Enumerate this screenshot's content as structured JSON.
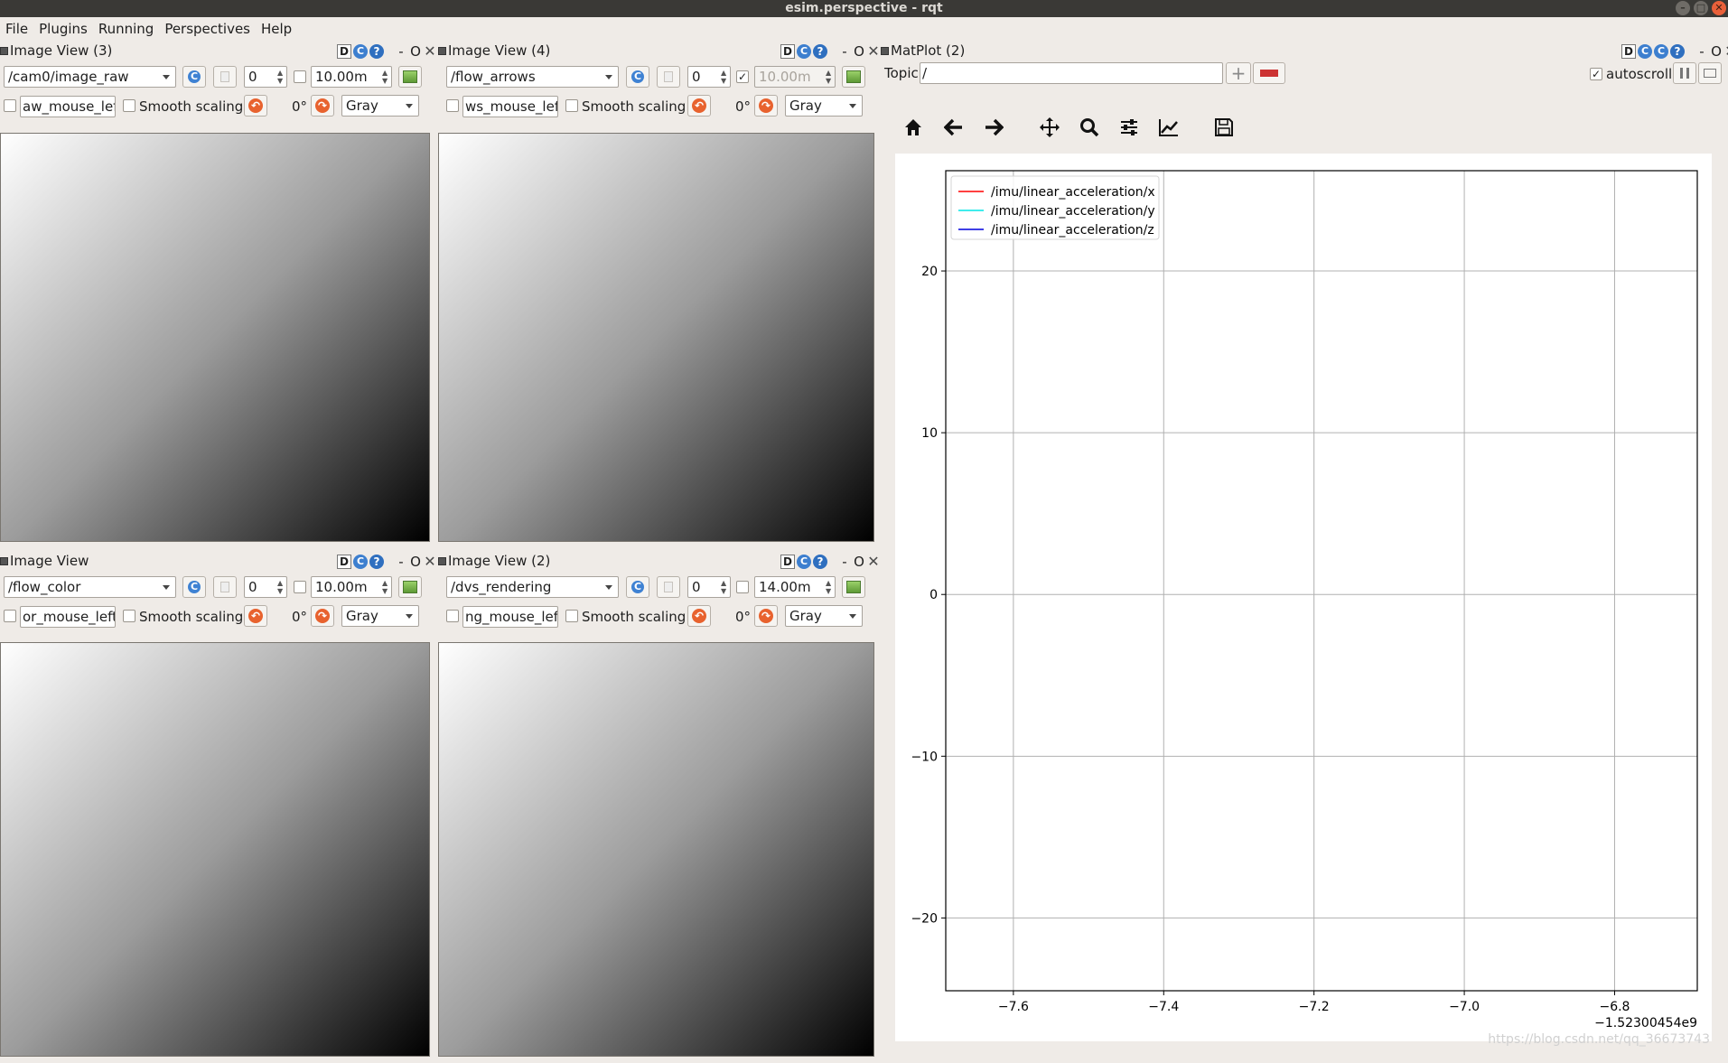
{
  "window": {
    "title": "esim.perspective - rqt",
    "buttons": [
      "–",
      "□",
      "✕"
    ]
  },
  "menu": {
    "items": [
      "File",
      "Plugins",
      "Running",
      "Perspectives",
      "Help"
    ]
  },
  "dock_controls": {
    "d": "D",
    "c": "C",
    "q": "?",
    "dash": "-",
    "o": "O",
    "x": "✕"
  },
  "panels": [
    {
      "title": "Image View (3)",
      "topic": "/cam0/image_raw",
      "spin_value": "0",
      "fps_checked": "",
      "fps_value": "10.00m",
      "mouse_topic": "aw_mouse_left",
      "smooth_label": "Smooth scaling",
      "rotation": "0°",
      "colormap": "Gray"
    },
    {
      "title": "Image View (4)",
      "topic": "/flow_arrows",
      "spin_value": "0",
      "fps_checked": "✓",
      "fps_value": "10.00m",
      "mouse_topic": "ws_mouse_left",
      "smooth_label": "Smooth scaling",
      "rotation": "0°",
      "colormap": "Gray"
    },
    {
      "title": "Image View",
      "topic": "/flow_color",
      "spin_value": "0",
      "fps_checked": "",
      "fps_value": "10.00m",
      "mouse_topic": "or_mouse_left",
      "smooth_label": "Smooth scaling",
      "rotation": "0°",
      "colormap": "Gray"
    },
    {
      "title": "Image View (2)",
      "topic": "/dvs_rendering",
      "spin_value": "0",
      "fps_checked": "",
      "fps_value": "14.00m",
      "mouse_topic": "ng_mouse_left",
      "smooth_label": "Smooth scaling",
      "rotation": "0°",
      "colormap": "Gray"
    }
  ],
  "matplot": {
    "title": "MatPlot (2)",
    "topic_label": "Topic",
    "topic_value": "/",
    "add": "+",
    "remove": "−",
    "autoscroll_label": "autoscroll",
    "autoscroll_checked": "✓"
  },
  "toolbar_icons": [
    "home-icon",
    "back-arrow-icon",
    "forward-arrow-icon",
    "pan-icon",
    "zoom-icon",
    "configure-subplots-icon",
    "edit-curves-icon",
    "save-icon"
  ],
  "watermark": "https://blog.csdn.net/qq_36673743",
  "chart_data": {
    "type": "line",
    "series": [
      {
        "name": "/imu/linear_acceleration/x",
        "color": "#ff0000",
        "values": []
      },
      {
        "name": "/imu/linear_acceleration/y",
        "color": "#00e5e5",
        "values": []
      },
      {
        "name": "/imu/linear_acceleration/z",
        "color": "#0000dd",
        "values": []
      }
    ],
    "xlim": [
      -7.69,
      -6.69
    ],
    "ylim": [
      -24.5,
      26.2
    ],
    "xticks": [
      -7.6,
      -7.4,
      -7.2,
      -7.0,
      -6.8
    ],
    "xtick_labels": [
      "−7.6",
      "−7.4",
      "−7.2",
      "−7.0",
      "−6.8"
    ],
    "yticks": [
      20,
      10,
      0,
      -10,
      -20
    ],
    "ytick_labels": [
      "20",
      "10",
      "0",
      "−10",
      "−20"
    ],
    "x_offset_label": "−1.52300454e9",
    "grid": true,
    "legend": "top-left"
  }
}
